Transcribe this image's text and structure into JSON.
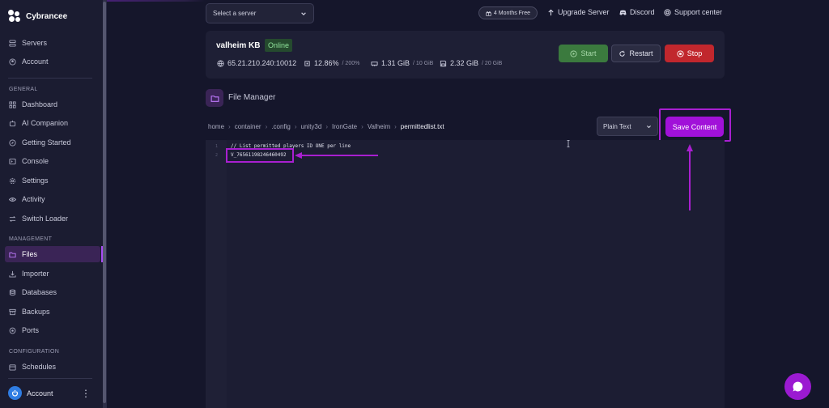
{
  "brand": {
    "name": "Cybrancee"
  },
  "sidebar": {
    "top_items": [
      {
        "label": "Servers",
        "icon": "server-icon"
      },
      {
        "label": "Account",
        "icon": "account-icon"
      }
    ],
    "sections": [
      {
        "title": "GENERAL",
        "items": [
          {
            "label": "Dashboard",
            "icon": "dashboard-icon"
          },
          {
            "label": "AI Companion",
            "icon": "ai-icon"
          },
          {
            "label": "Getting Started",
            "icon": "compass-icon"
          },
          {
            "label": "Console",
            "icon": "terminal-icon"
          },
          {
            "label": "Settings",
            "icon": "gear-icon"
          },
          {
            "label": "Activity",
            "icon": "eye-icon"
          },
          {
            "label": "Switch Loader",
            "icon": "swap-icon"
          }
        ]
      },
      {
        "title": "MANAGEMENT",
        "items": [
          {
            "label": "Files",
            "icon": "folder-icon",
            "active": true
          },
          {
            "label": "Importer",
            "icon": "import-icon"
          },
          {
            "label": "Databases",
            "icon": "database-icon"
          },
          {
            "label": "Backups",
            "icon": "archive-icon"
          },
          {
            "label": "Ports",
            "icon": "plug-icon"
          }
        ]
      },
      {
        "title": "CONFIGURATION",
        "items": [
          {
            "label": "Schedules",
            "icon": "calendar-icon"
          }
        ]
      }
    ],
    "footer_account": "Account"
  },
  "topbar": {
    "server_select_placeholder": "Select a server",
    "promo": "4 Months Free",
    "links": [
      "Upgrade Server",
      "Discord",
      "Support center"
    ]
  },
  "server": {
    "name": "valheim KB",
    "status": "Online",
    "address": "65.21.210.240:10012",
    "cpu": "12.86%",
    "cpu_max": "/ 200%",
    "memory": "1.31 GiB",
    "memory_max": "/ 10 GiB",
    "disk": "2.32 GiB",
    "disk_max": "/ 20 GiB",
    "buttons": {
      "start": "Start",
      "restart": "Restart",
      "stop": "Stop"
    }
  },
  "file_manager": {
    "title": "File Manager",
    "breadcrumb": [
      "home",
      "container",
      ".config",
      "unity3d",
      "IronGate",
      "Valheim",
      "permittedlist.txt"
    ],
    "language": "Plain Text",
    "save_label": "Save Content"
  },
  "editor": {
    "lines": [
      {
        "num": "1",
        "text": "// List permitted players ID ONE per line"
      },
      {
        "num": "2",
        "text": "V_76561198246460492"
      }
    ]
  },
  "colors": {
    "accent": "#a111d9",
    "annotation": "#a81fd0",
    "online": "#8ee29a",
    "stop": "#c1272d",
    "start": "#3b7a3e"
  }
}
